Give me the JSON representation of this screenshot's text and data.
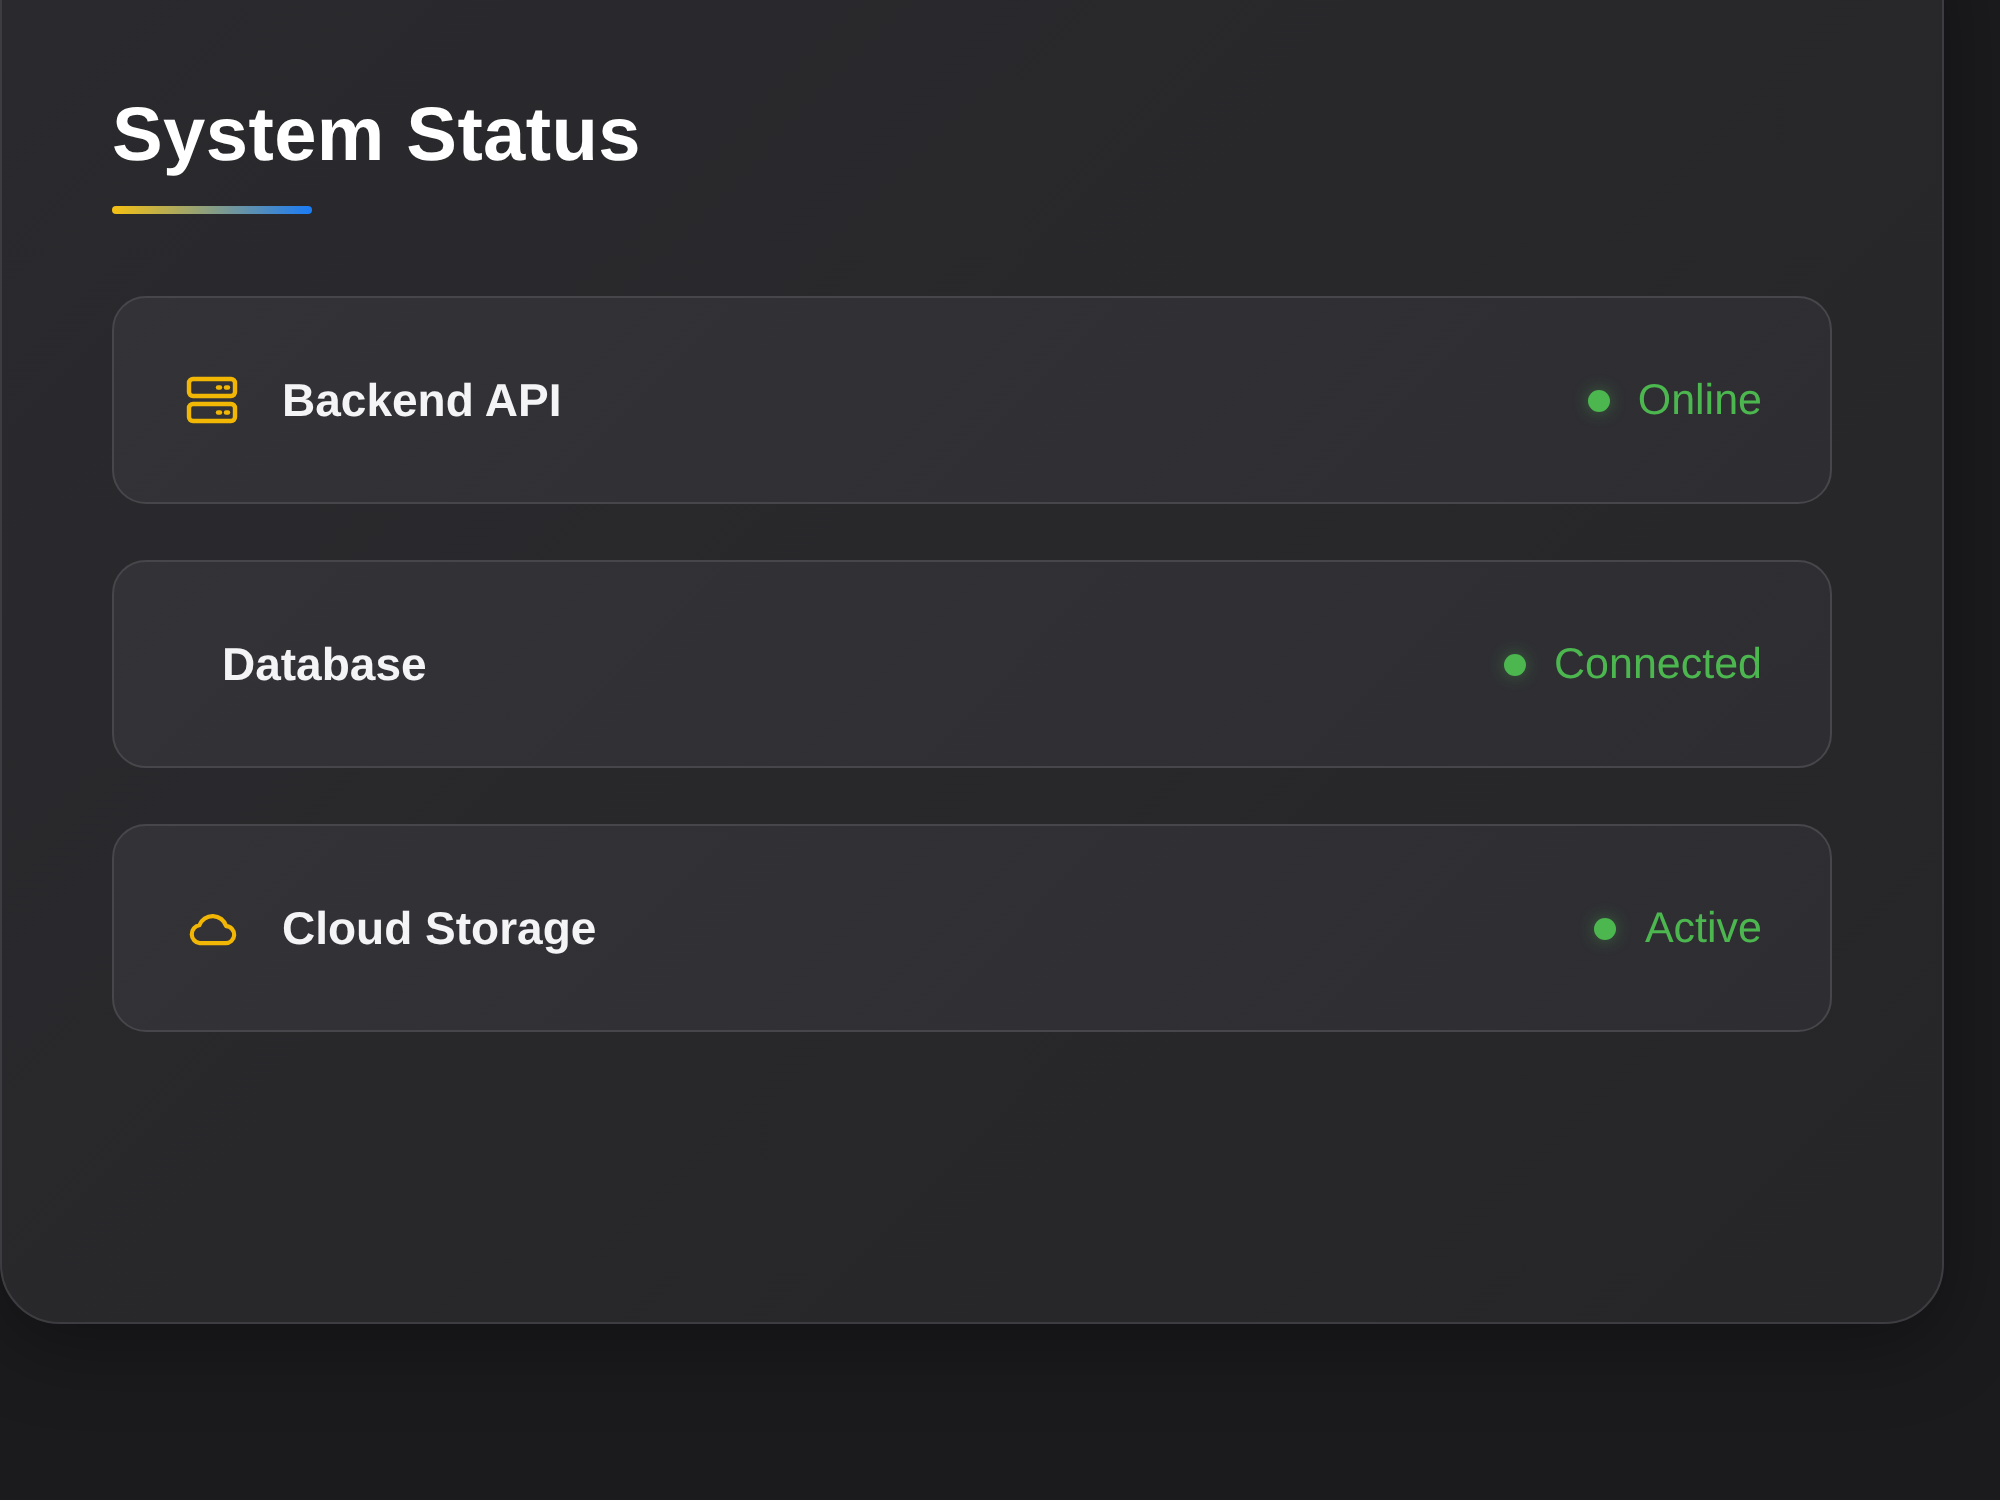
{
  "title": "System Status",
  "services": [
    {
      "kind": "server",
      "name": "Backend API",
      "status": "Online",
      "color": "#4cb64f"
    },
    {
      "kind": "plain",
      "name": "Database",
      "status": "Connected",
      "color": "#4cb64f"
    },
    {
      "kind": "cloud",
      "name": "Cloud Storage",
      "status": "Active",
      "color": "#4cb64f"
    }
  ]
}
